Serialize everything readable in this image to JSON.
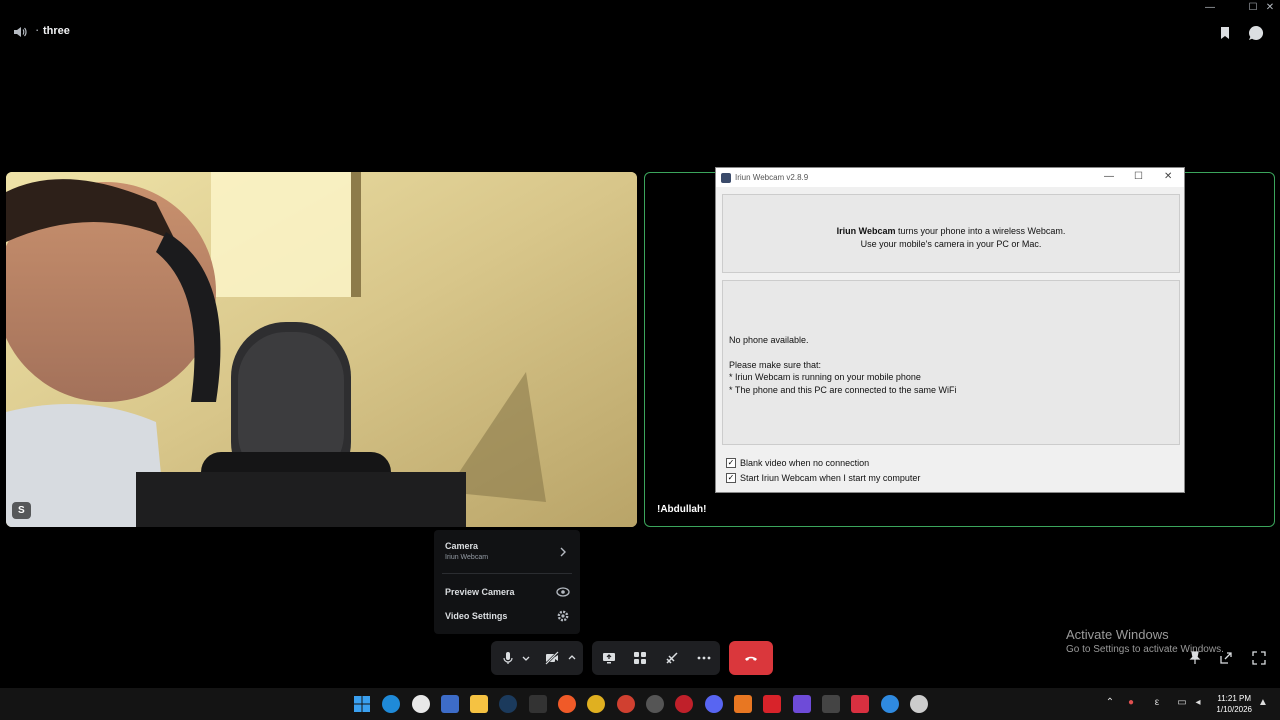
{
  "header": {
    "channel_name": "three",
    "channel_prefix": "·"
  },
  "tiles": {
    "left_label": "S",
    "right_label": "!Abdullah!"
  },
  "iriun": {
    "title": "Iriun Webcam v2.8.9",
    "intro_brand": "Iriun Webcam",
    "intro_rest": " turns your phone into a wireless Webcam.",
    "intro_line2": "Use your mobile's camera in your PC or Mac.",
    "status": "No phone available.",
    "make_sure": "Please make sure that:",
    "bullet1": "* Iriun Webcam is running on your mobile phone",
    "bullet2": "* The phone and this PC are connected to the same WiFi",
    "checkbox1": "Blank video when no connection",
    "checkbox2": "Start Iriun Webcam when I start my computer",
    "checkbox1_checked": true,
    "checkbox2_checked": true
  },
  "popup": {
    "camera_label": "Camera",
    "camera_value": "Iriun Webcam",
    "preview_label": "Preview Camera",
    "settings_label": "Video Settings"
  },
  "watermark": {
    "line1": "Activate Windows",
    "line2": "Go to Settings to activate Windows."
  },
  "taskbar": {
    "time": "11:21 PM",
    "date": "1/10/2026",
    "lang": "ε"
  },
  "colors": {
    "accent_green": "#3ba55c",
    "hangup_red": "#da373c",
    "background": "#000000"
  }
}
